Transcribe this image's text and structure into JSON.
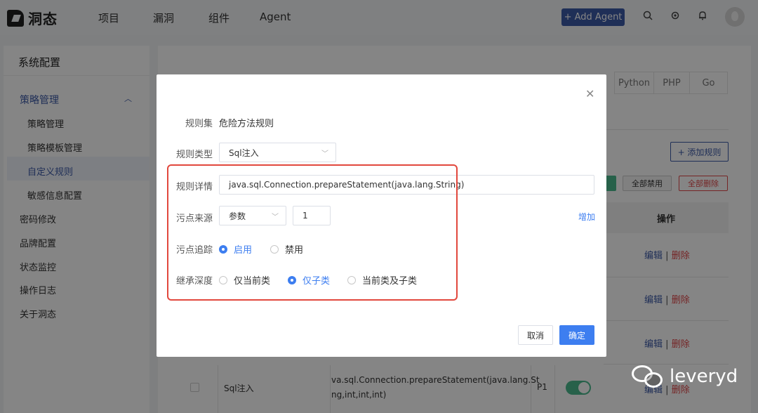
{
  "app": {
    "logo_text": "洞态"
  },
  "nav": {
    "items": [
      "项目",
      "漏洞",
      "组件",
      "Agent"
    ],
    "add_agent": "+ Add Agent"
  },
  "sidebar": {
    "title": "系统配置",
    "group": "策略管理",
    "sub_items": [
      "策略管理",
      "策略模板管理",
      "自定义规则",
      "敏感信息配置"
    ],
    "items": [
      "密码修改",
      "品牌配置",
      "状态监控",
      "操作日志",
      "关于洞态"
    ]
  },
  "background": {
    "lang_tabs": [
      "Python",
      "PHP",
      "Go"
    ],
    "add_rule": "+ 添加规则",
    "disable_all": "全部禁用",
    "delete_all": "全部删除",
    "op_header": "操作",
    "op_edit": "编辑",
    "op_sep": "|",
    "op_delete": "删除",
    "row": {
      "type": "Sql注入",
      "signature_l1": "va.sql.Connection.prepareStatement(java.lang.St",
      "signature_l2": "ng,int,int,int)",
      "level": "P1"
    }
  },
  "modal": {
    "ruleset_label": "规则集",
    "ruleset_value": "危险方法规则",
    "rule_type_label": "规则类型",
    "rule_type_value": "Sql注入",
    "detail_label": "规则详情",
    "detail_value": "java.sql.Connection.prepareStatement(java.lang.String)",
    "source_label": "污点来源",
    "source_type": "参数",
    "source_index": "1",
    "add_link": "增加",
    "track_label": "污点追踪",
    "track_on": "启用",
    "track_off": "禁用",
    "inherit_label": "继承深度",
    "inherit_opts": [
      "仅当前类",
      "仅子类",
      "当前类及子类"
    ],
    "cancel": "取消",
    "ok": "确定"
  },
  "watermark": "leveryd",
  "colors": {
    "primary": "#3d7ef0",
    "nav_button": "#3d5aa8",
    "danger": "#e0474a",
    "highlight": "#e2483d"
  }
}
